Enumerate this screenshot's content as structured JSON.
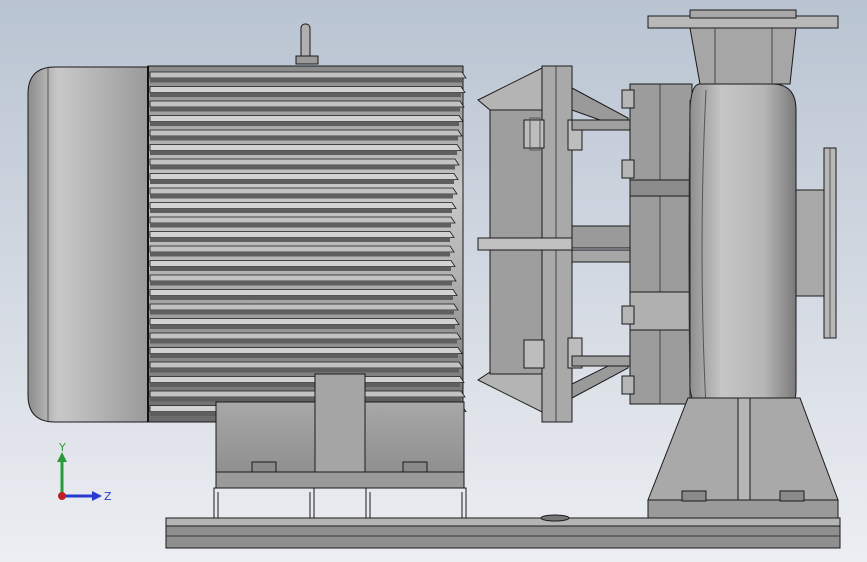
{
  "viewport": {
    "background_top": "#b9c4d2",
    "background_bottom": "#eceef2"
  },
  "model": {
    "description_icon": "centrifugal-pump-motor-assembly",
    "metal_light": "#c4c4c4",
    "metal_mid": "#a3a3a3",
    "metal_dark": "#6f6f6f",
    "edge": "#1a1a1a"
  },
  "triad": {
    "y_label": "Y",
    "z_label": "Z",
    "y_color": "#2a9a3a",
    "z_color": "#2a3ad0",
    "origin_color": "#c02020"
  }
}
